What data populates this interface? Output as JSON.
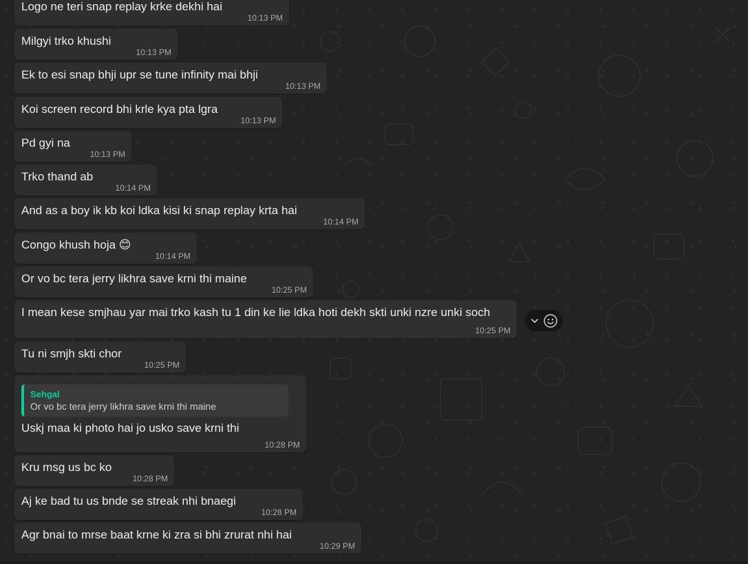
{
  "messages": [
    {
      "text": "Logo ne teri snap replay krke dekhi hai",
      "time": "10:13 PM"
    },
    {
      "text": "Milgyi trko khushi",
      "time": "10:13 PM"
    },
    {
      "text": "Ek to esi snap bhji upr se tune infinity mai bhji",
      "time": "10:13 PM"
    },
    {
      "text": "Koi screen record bhi krle kya pta lgra",
      "time": "10:13 PM"
    },
    {
      "text": "Pd gyi na",
      "time": "10:13 PM"
    },
    {
      "text": "Trko thand ab",
      "time": "10:14 PM"
    },
    {
      "text": "And as a boy ik kb koi ldka kisi ki snap replay krta hai",
      "time": "10:14 PM"
    },
    {
      "text": "Congo khush hoja",
      "emoji": "😊",
      "time": "10:14 PM"
    },
    {
      "text": "Or vo bc tera jerry likhra save krni thi maine",
      "time": "10:25 PM"
    },
    {
      "text": "I mean kese smjhau yar mai trko kash tu 1 din ke lie ldka hoti dekh skti unki nzre unki soch",
      "time": "10:25 PM"
    },
    {
      "text": "Tu ni smjh skti chor",
      "time": "10:25 PM"
    },
    {
      "text": "Uskj maa ki photo hai jo usko save krni thi",
      "time": "10:28 PM",
      "quote": {
        "author": "Sehgal",
        "text": "Or vo bc tera jerry likhra save krni thi maine"
      }
    },
    {
      "text": "Kru msg us bc ko",
      "time": "10:28 PM"
    },
    {
      "text": "Aj ke bad tu us bnde se streak nhi bnaegi",
      "time": "10:28 PM"
    },
    {
      "text": "Agr bnai to mrse baat krne ki zra si bhi zrurat nhi hai",
      "time": "10:29 PM"
    }
  ],
  "hover_actions": {
    "icons": [
      "chevron-down-icon",
      "emoji-react-icon"
    ]
  },
  "colors": {
    "background": "#232323",
    "bubble": "#2e2e2e",
    "text": "#ececec",
    "timestamp": "#a9a9a9",
    "quote_accent": "#06cf9c"
  }
}
